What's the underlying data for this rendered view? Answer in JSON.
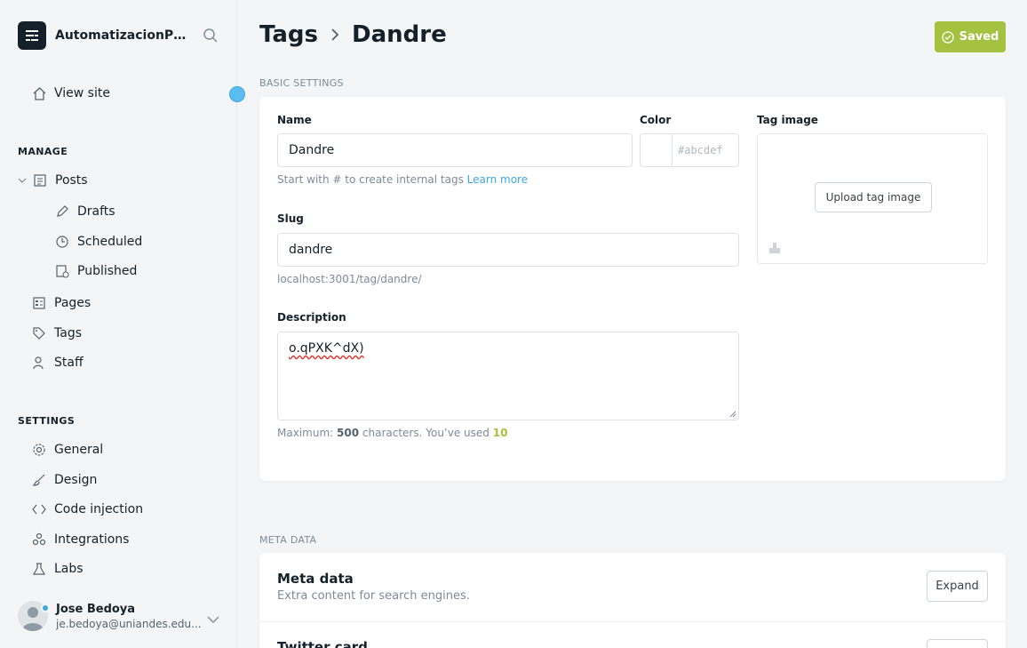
{
  "sidebar": {
    "brand_name": "AutomatizacionPr...",
    "view_site": "View site",
    "manage_title": "MANAGE",
    "posts": "Posts",
    "drafts": "Drafts",
    "scheduled": "Scheduled",
    "published": "Published",
    "pages": "Pages",
    "tags": "Tags",
    "staff": "Staff",
    "settings_title": "SETTINGS",
    "general": "General",
    "design": "Design",
    "code_injection": "Code injection",
    "integrations": "Integrations",
    "labs": "Labs",
    "user_name": "Jose Bedoya",
    "user_email": "je.bedoya@uniandes.edu..."
  },
  "header": {
    "crumb_parent": "Tags",
    "crumb_current": "Dandre",
    "saved_label": "Saved"
  },
  "basic": {
    "section_title": "BASIC SETTINGS",
    "name_label": "Name",
    "name_value": "Dandre",
    "name_hint": "Start with # to create internal tags",
    "learn_more": "Learn more",
    "color_label": "Color",
    "color_placeholder": "#abcdef",
    "slug_label": "Slug",
    "slug_value": "dandre",
    "slug_url": "localhost:3001/tag/dandre/",
    "description_label": "Description",
    "description_value": "o.qPXK^dX)",
    "desc_hint_prefix": "Maximum:",
    "desc_max": "500",
    "desc_hint_mid": "characters. You’ve used",
    "desc_used": "10",
    "tag_image_label": "Tag image",
    "upload_label": "Upload tag image"
  },
  "meta": {
    "section_title": "META DATA",
    "meta_title": "Meta data",
    "meta_sub": "Extra content for search engines.",
    "expand_label": "Expand",
    "twitter_title": "Twitter card"
  },
  "colors": {
    "accent_green": "#a4c13f",
    "link_blue": "#3ea7e0"
  }
}
